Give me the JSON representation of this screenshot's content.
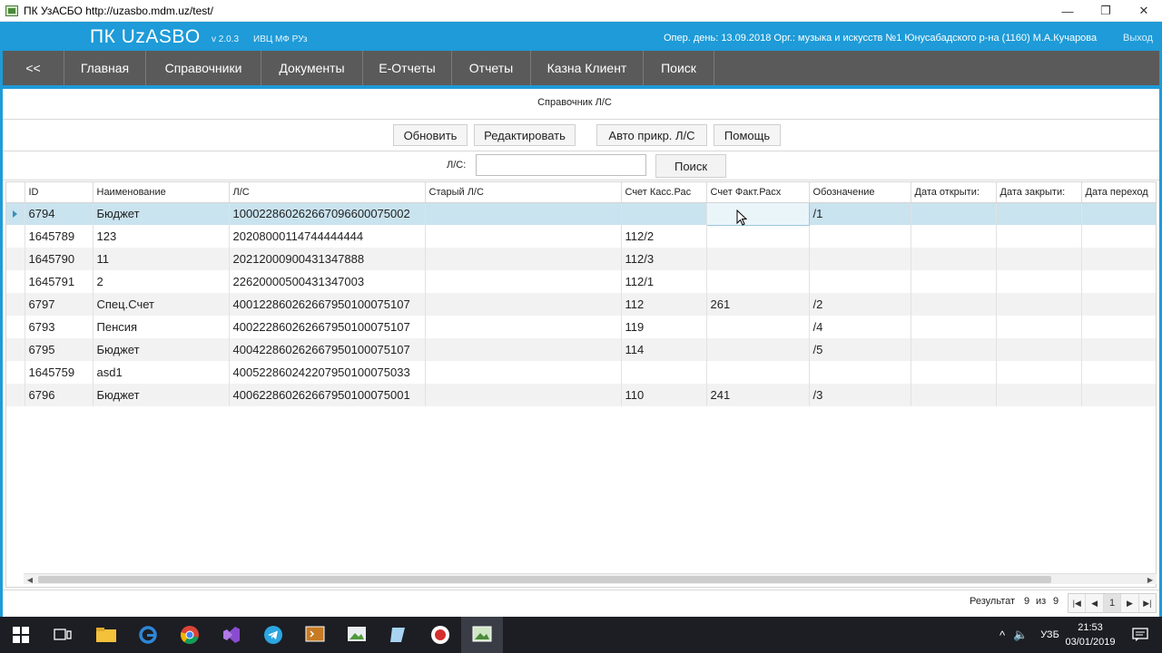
{
  "window": {
    "title": "ПК УзАСБО http://uzasbo.mdm.uz/test/",
    "minimize": "—",
    "maximize": "❐",
    "close": "✕"
  },
  "header": {
    "logo": "ПК UzASBO",
    "version": "v 2.0.3",
    "org": "ИВЦ МФ РУз",
    "oper": "Опер. день: 13.09.2018 Орг.: музыка и искусств №1 Юнусабадского р-на (1160) М.А.Кучарова",
    "exit": "Выход"
  },
  "nav": {
    "items": [
      "<<",
      "Главная",
      "Справочники",
      "Документы",
      "Е-Отчеты",
      "Отчеты",
      "Казна Клиент",
      "Поиск"
    ]
  },
  "page": {
    "title": "Справочник Л/С"
  },
  "toolbar": {
    "refresh": "Обновить",
    "edit": "Редактировать",
    "auto_attach": "Авто прикр. Л/С",
    "help": "Помощь"
  },
  "search": {
    "label": "Л/С:",
    "value": "",
    "button": "Поиск"
  },
  "table": {
    "columns": [
      "ID",
      "Наименование",
      "Л/С",
      "Старый Л/С",
      "Счет Касс.Рас",
      "Счет Факт.Расх",
      "Обозначение",
      "Дата открыти:",
      "Дата закрыти:",
      "Дата переход"
    ],
    "rows": [
      [
        "6794",
        "Бюджет",
        "100022860262667096600075002",
        "",
        "",
        "",
        "/1",
        "",
        "",
        ""
      ],
      [
        "1645789",
        "123",
        "20208000114744444444",
        "",
        "112/2",
        "",
        "",
        "",
        "",
        ""
      ],
      [
        "1645790",
        "11",
        "20212000900431347888",
        "",
        "112/3",
        "",
        "",
        "",
        "",
        ""
      ],
      [
        "1645791",
        "2",
        "22620000500431347003",
        "",
        "112/1",
        "",
        "",
        "",
        "",
        ""
      ],
      [
        "6797",
        "Спец.Счет",
        "400122860262667950100075107",
        "",
        "112",
        "261",
        "/2",
        "",
        "",
        ""
      ],
      [
        "6793",
        "Пенсия",
        "400222860262667950100075107",
        "",
        "119",
        "",
        "/4",
        "",
        "",
        ""
      ],
      [
        "6795",
        "Бюджет",
        "400422860262667950100075107",
        "",
        "114",
        "",
        "/5",
        "",
        "",
        ""
      ],
      [
        "1645759",
        "asd1",
        "400522860242207950100075033",
        "",
        "",
        "",
        "",
        "",
        "",
        ""
      ],
      [
        "6796",
        "Бюджет",
        "400622860262667950100075001",
        "",
        "110",
        "241",
        "/3",
        "",
        "",
        ""
      ]
    ]
  },
  "pager": {
    "result_label": "Результат",
    "current": "9",
    "of_label": "из",
    "total": "9",
    "page": "1"
  },
  "taskbar": {
    "lang": "УЗБ",
    "time": "21:53",
    "date": "03/01/2019"
  }
}
